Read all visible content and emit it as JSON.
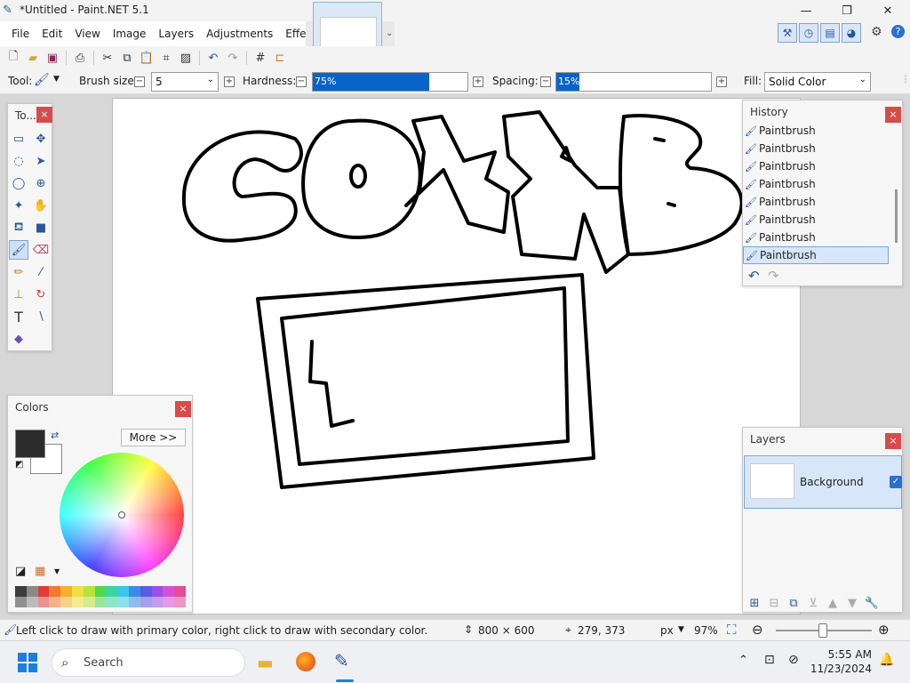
{
  "window": {
    "title": "*Untitled - Paint.NET 5.1",
    "minimize": "—",
    "maximize": "❐",
    "close": "✕"
  },
  "menu": [
    "File",
    "Edit",
    "View",
    "Image",
    "Layers",
    "Adjustments",
    "Effects"
  ],
  "toolbar": {
    "tool_label": "Tool:",
    "brush_size_label": "Brush size:",
    "brush_size_value": "5",
    "hardness_label": "Hardness:",
    "hardness_value": "75%",
    "hardness_fraction": 0.75,
    "spacing_label": "Spacing:",
    "spacing_value": "15%",
    "spacing_fraction": 0.15,
    "fill_label": "Fill:",
    "fill_value": "Solid Color"
  },
  "tools_panel": {
    "title": "To..."
  },
  "history": {
    "title": "History",
    "items": [
      "Paintbrush",
      "Paintbrush",
      "Paintbrush",
      "Paintbrush",
      "Paintbrush",
      "Paintbrush",
      "Paintbrush",
      "Paintbrush"
    ],
    "selected_index": 7
  },
  "colors": {
    "title": "Colors",
    "more_button": "More >>",
    "primary": "#2b2b2b",
    "secondary": "#ffffff"
  },
  "layers": {
    "title": "Layers",
    "items": [
      {
        "name": "Background",
        "visible": true
      }
    ]
  },
  "status": {
    "hint": "Left click to draw with primary color, right click to draw with secondary color.",
    "image_size": "800 × 600",
    "cursor_pos": "279, 373",
    "units": "px",
    "zoom": "97%"
  },
  "taskbar": {
    "search_placeholder": "Search",
    "time": "5:55 AM",
    "date": "11/23/2024"
  },
  "palette": [
    "#3c3c3c",
    "#8a8a8a",
    "#e03c3c",
    "#f07a32",
    "#f5b031",
    "#f0e040",
    "#b6e43c",
    "#52d652",
    "#3ad6a0",
    "#3ac8e6",
    "#3a8ce6",
    "#5a5ae6",
    "#9a50e6",
    "#d650d6",
    "#e64a9a"
  ],
  "accent": "#0a63c9"
}
